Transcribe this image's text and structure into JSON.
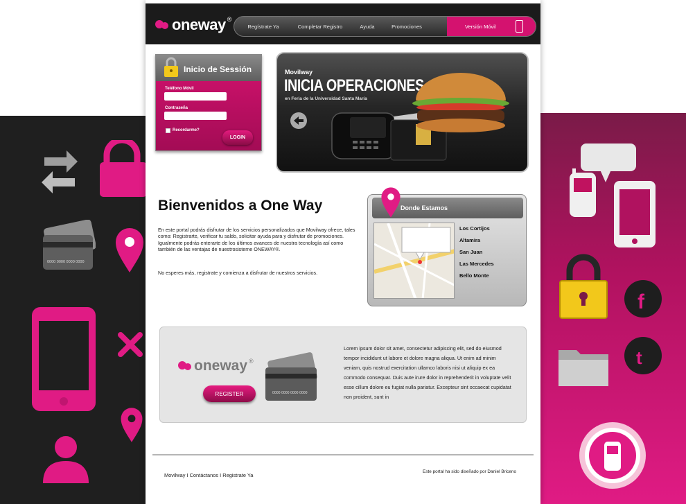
{
  "brand": {
    "name": "oneway",
    "reg": "®"
  },
  "nav": {
    "items": [
      "Regístrate Ya",
      "Completar Registro",
      "Ayuda",
      "Promociones"
    ],
    "mobile": "Versión Móvil"
  },
  "login": {
    "title": "Inicio de Sessión",
    "phone_label": "Teléfono Móvil",
    "password_label": "Contraseña",
    "remember_label": "Recordarme?",
    "button": "LOGIN"
  },
  "banner": {
    "brand": "Movilway",
    "title": "INICIA OPERACIONES",
    "subtitle": "en Feria de la Universidad Santa María",
    "prev_icon": "arrow-left-icon"
  },
  "welcome": {
    "title": "Bienvenidos a One Way",
    "body": "En este portal podrás disfrutar de los servicios personalizados que Movilway ofrece, tales como: Registrarte, verificar tu saldo, solicitar ayuda para y disfrutar de promociones. Igualmente podrás enterarte de los últimos avances de nuestra tecnología así como también de las ventajas de nuestrosisteme ONEWAY®.",
    "cta": "No esperes más, registrate y comienza a disfrutar de nuestros servicios."
  },
  "where": {
    "title": "Donde Estamos",
    "locations": [
      "Los Cortijos",
      "Altamira",
      "San Juan",
      "Las Mercedes",
      "Bello Monte"
    ]
  },
  "register": {
    "button": "REGISTER",
    "card_number": "0000 0000 0000 0000",
    "text": "Lorem ipsum dolor sit amet, consectetur adipiscing elit, sed do eiusmod tempor incididunt ut labore et dolore magna aliqua. Ut enim ad minim veniam, quis nostrud exercitation ullamco laboris nisi ut aliquip ex ea commodo consequat. Duis aute irure dolor in reprehenderit in voluptate velit esse cillum dolore eu fugiat nulla pariatur. Excepteur sint occaecat cupidatat non proident, sunt in"
  },
  "footer": {
    "links": [
      "Movilway",
      "Contáctanos",
      "Registrate Ya"
    ],
    "separator": "I",
    "credit": "Este portal ha sido diseñado por Daniel Briceno"
  },
  "colors": {
    "accent": "#d4126f",
    "dark": "#1b1b1b",
    "panel_gray": "#e5e5e5"
  },
  "decorations": {
    "left": [
      "sync-icon",
      "lock-icon",
      "credit-card-icon",
      "map-pin-icon",
      "mobile-phone-icon",
      "close-icon",
      "map-pin-icon",
      "user-icon"
    ],
    "right": [
      "chat-bubble-icon",
      "cell-phone-icon",
      "tablet-icon",
      "padlock-icon",
      "facebook-icon",
      "folder-icon",
      "twitter-icon",
      "phone-badge-icon"
    ]
  }
}
